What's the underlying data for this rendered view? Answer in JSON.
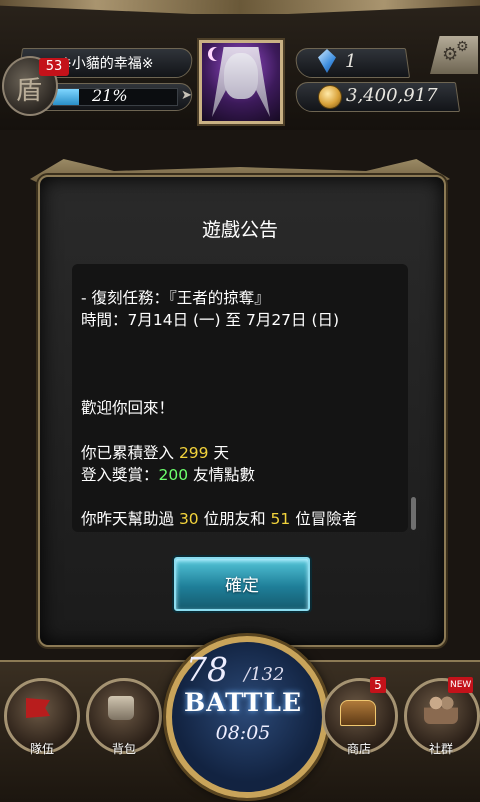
{
  "header": {
    "level": "53",
    "level_glyph": "盾",
    "player_name": "※小貓的幸福※",
    "exp_percent_text": "21%",
    "exp_fraction": 0.21,
    "gems": "1",
    "coins": "3,400,917"
  },
  "dialog": {
    "title": "遊戲公告",
    "lines": {
      "l1": "- 復刻任務：『王者的掠奪』",
      "l2": "時間：7月14日 (一) 至 7月27日 (日)",
      "welcome": "歡迎你回來！",
      "login_prefix": "你已累積登入 ",
      "login_days": "299",
      "login_suffix": " 天",
      "reward_prefix": "登入獎賞：",
      "reward_points": "200",
      "reward_suffix": " 友情點數",
      "help_prefix": "你昨天幫助過 ",
      "help_friends": "30",
      "help_mid": " 位朋友和 ",
      "help_adventurers": "51",
      "help_suffix": " 位冒險者"
    },
    "confirm_label": "確定"
  },
  "bottom": {
    "team_label": "隊伍",
    "bag_label": "背包",
    "shop_label": "商店",
    "social_label": "社群",
    "shop_badge": "5",
    "social_badge": "NEW",
    "stamina_current": "78",
    "stamina_max": "/132",
    "battle_label": "BATTLE",
    "timer": "08:05"
  },
  "colors": {
    "highlight_yellow": "#f2d33c",
    "highlight_green": "#6dff6d",
    "confirm_button": "#1f7f99",
    "badge_red": "#c4121a"
  }
}
